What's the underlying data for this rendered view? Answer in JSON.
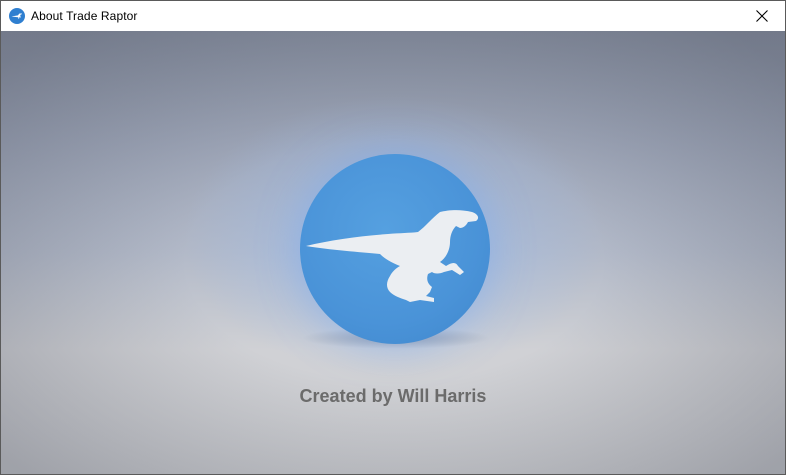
{
  "window": {
    "title": "About Trade Raptor",
    "app_icon": "raptor-app-icon",
    "close_icon": "close-icon"
  },
  "content": {
    "logo_icon": "raptor-logo-icon",
    "logo_color": "#4a93d8",
    "credit": "Created by Will Harris"
  }
}
